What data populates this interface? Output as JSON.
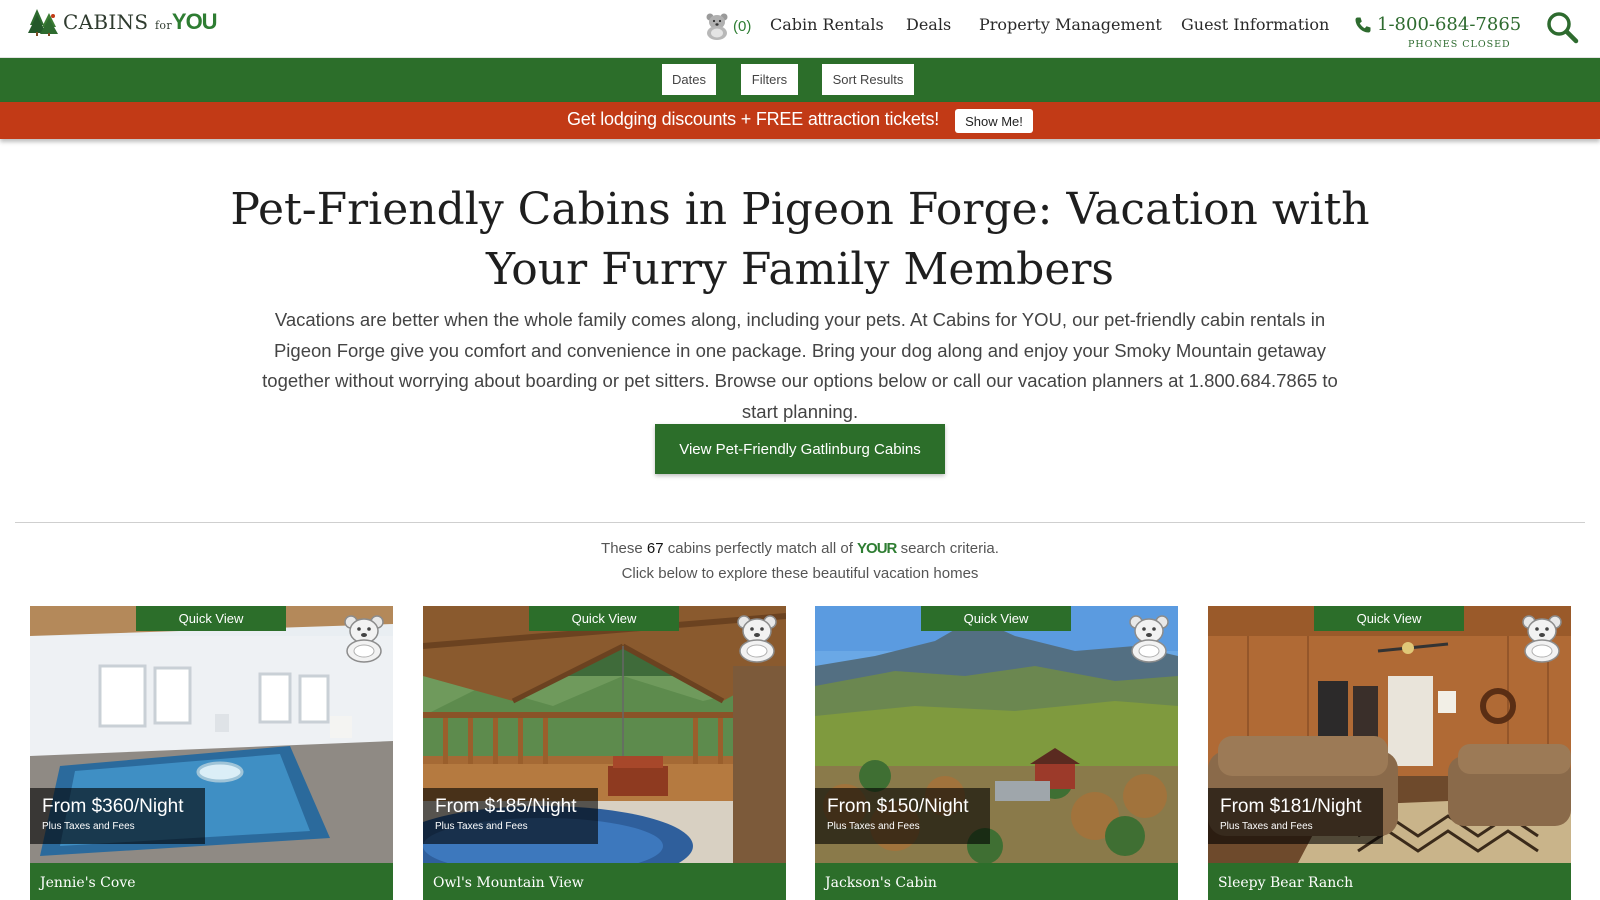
{
  "header": {
    "logo_main": "CABINS",
    "logo_for": "for",
    "logo_you": "YOU",
    "favorites_count": "(0)",
    "nav": [
      "Cabin Rentals",
      "Deals",
      "Property Management",
      "Guest Information"
    ],
    "phone": "1-800-684-7865",
    "phone_status": "PHONES CLOSED"
  },
  "toolbar": {
    "dates": "Dates",
    "filters": "Filters",
    "sort": "Sort Results"
  },
  "promo": {
    "text": "Get lodging discounts + FREE attraction tickets!",
    "button": "Show Me!"
  },
  "hero": {
    "title": "Pet-Friendly Cabins in Pigeon Forge: Vacation with Your Furry Family Members",
    "text": "Vacations are better when the whole family comes along, including your pets. At Cabins for YOU, our pet-friendly cabin rentals in Pigeon Forge give you comfort and convenience in one package. Bring your dog along and enjoy your Smoky Mountain getaway together without worrying about boarding or pet sitters. Browse our options below or call our vacation planners at 1.800.684.7865 to start planning.",
    "cta": "View Pet-Friendly Gatlinburg Cabins"
  },
  "results": {
    "prefix": "These",
    "count": "67",
    "middle": "cabins perfectly match all of",
    "you": "YOUR",
    "suffix": "search criteria.",
    "subline": "Click below to explore these beautiful vacation homes"
  },
  "cards": [
    {
      "name": "Jennie's Cove",
      "price": "From $360/Night",
      "note": "Plus Taxes and Fees",
      "quick_view": "Quick View",
      "scene": "indoor-pool"
    },
    {
      "name": "Owl's Mountain View",
      "price": "From $185/Night",
      "note": "Plus Taxes and Fees",
      "quick_view": "Quick View",
      "scene": "porch-swing-hot-tub"
    },
    {
      "name": "Jackson's Cabin",
      "price": "From $150/Night",
      "note": "Plus Taxes and Fees",
      "quick_view": "Quick View",
      "scene": "mountain-view"
    },
    {
      "name": "Sleepy Bear Ranch",
      "price": "From $181/Night",
      "note": "Plus Taxes and Fees",
      "quick_view": "Quick View",
      "scene": "living-room"
    }
  ],
  "colors": {
    "brand_green": "#2c6e2a",
    "promo_red": "#c23a16",
    "logo_green": "#2e7d32"
  },
  "icons": [
    "trees-logo-icon",
    "bear-favorites-icon",
    "phone-icon",
    "search-icon",
    "bear-favorite-icon"
  ]
}
